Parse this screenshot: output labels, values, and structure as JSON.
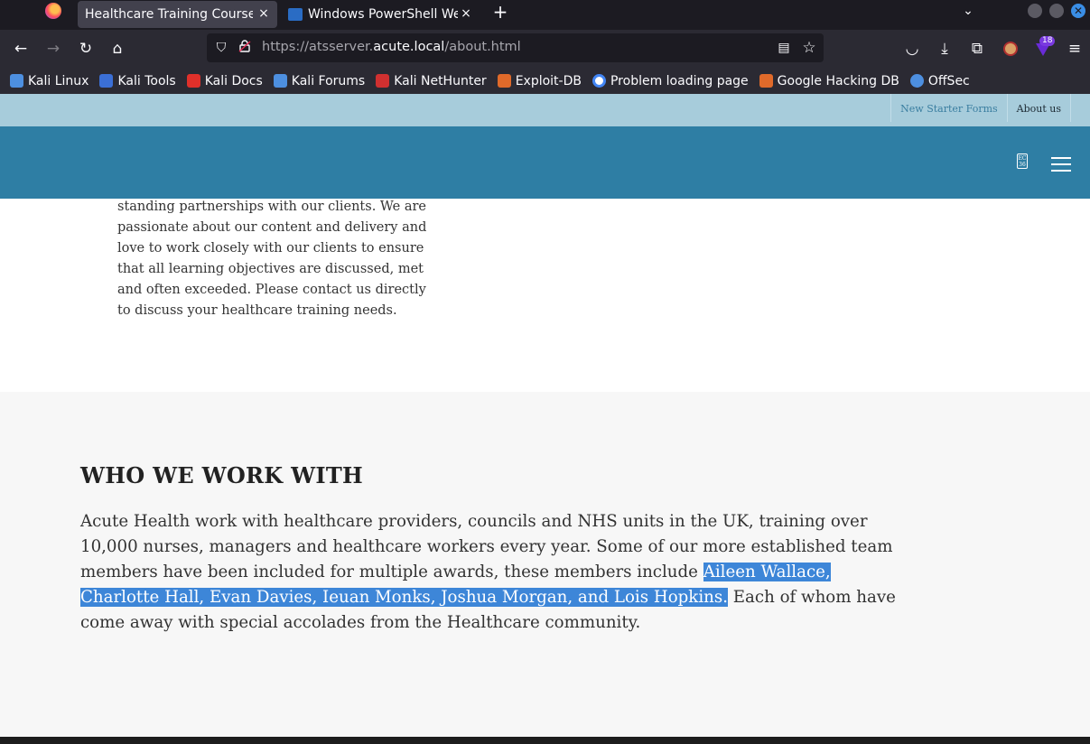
{
  "browser": {
    "tabs": [
      {
        "title": "Healthcare Training Courses",
        "active": true
      },
      {
        "title": "Windows PowerShell Web",
        "active": false
      }
    ],
    "tab_close": "×",
    "new_tab": "+",
    "url_prefix": "https://atsserver.",
    "url_host": "acute.local",
    "url_path": "/about.html",
    "badge_count": "18",
    "icons": {
      "back": "←",
      "forward": "→",
      "reload": "↻",
      "home": "⌂",
      "shield": "⛉",
      "reader": "▤",
      "star": "☆",
      "pocket": "◡",
      "download": "⤓",
      "extensions": "⧉",
      "menu": "≡",
      "chevron": "⌄"
    }
  },
  "bookmarks": [
    {
      "label": "Kali Linux",
      "color": "#4d8fe0"
    },
    {
      "label": "Kali Tools",
      "color": "#3b6fd6"
    },
    {
      "label": "Kali Docs",
      "color": "#e0302a"
    },
    {
      "label": "Kali Forums",
      "color": "#4d8fe0"
    },
    {
      "label": "Kali NetHunter",
      "color": "#d03030"
    },
    {
      "label": "Exploit-DB",
      "color": "#e06a2a"
    },
    {
      "label": "Problem loading page",
      "color": "#ffffff"
    },
    {
      "label": "Google Hacking DB",
      "color": "#e06a2a"
    },
    {
      "label": "OffSec",
      "color": "#4d8fe0"
    }
  ],
  "site": {
    "top_links": [
      "New Starter Forms",
      "About us"
    ],
    "phone_icon_text": "EC 36",
    "intro_text": "standing partnerships with our clients. We are passionate about our content and delivery and love to work closely with our clients to ensure that all learning objectives are discussed, met and often exceeded. Please contact us directly to discuss your healthcare training needs.",
    "section_heading": "WHO WE WORK WITH",
    "body_before": "Acute Health work with healthcare providers, councils and NHS units in the UK, training over 10,000 nurses, managers and healthcare workers every year. Some of our more established team members have been included for multiple awards, these members include ",
    "body_highlight": "Aileen Wallace, Charlotte Hall, Evan Davies, Ieuan Monks, Joshua Morgan, and Lois Hopkins.",
    "body_after": " Each of whom have come away with special accolades from the Healthcare community."
  },
  "colors": {
    "header": "#2e7ea4",
    "top_strip": "#a7ccdb",
    "highlight": "#3d86d8"
  }
}
